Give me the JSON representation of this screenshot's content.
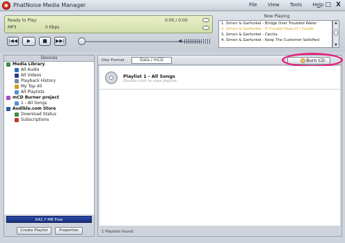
{
  "window": {
    "title": "PhatNoise Media Manager"
  },
  "menu": [
    "File",
    "View",
    "Tools",
    "Help"
  ],
  "window_controls": "_ □ X",
  "player": {
    "status": "Ready to Play:",
    "format": "MP3",
    "bitrate": "0 Kbps",
    "time": "0:00 / 0:00",
    "buttons": [
      "prev",
      "play",
      "stop",
      "next"
    ]
  },
  "now_playing": {
    "header": "Now Playing",
    "tracks": [
      "1. Simon & Garfunkel - Bridge Over Troubled Water",
      "2. Simon & Garfunkel - El Condor Pasa (If I Could)",
      "3. Simon & Garfunkel - Cecilia",
      "4. Simon & Garfunkel - Keep The Customer Satisfied"
    ],
    "active_index": 1
  },
  "devices": {
    "header": "Devices",
    "tree": [
      {
        "label": "Media Library",
        "bold": true,
        "indent": 0,
        "icon": "library-icon"
      },
      {
        "label": "All Audio",
        "indent": 1,
        "icon": "headphones-icon"
      },
      {
        "label": "All Videos",
        "indent": 1,
        "icon": "video-icon"
      },
      {
        "label": "Playback History",
        "indent": 1,
        "icon": "history-icon"
      },
      {
        "label": "My Top 40",
        "indent": 1,
        "icon": "top40-icon"
      },
      {
        "label": "All Playlists",
        "indent": 1,
        "icon": "playlists-icon"
      },
      {
        "label": "mCD Burner project",
        "bold": true,
        "indent": 0,
        "icon": "cd-burner-icon"
      },
      {
        "label": "1 - All Songs",
        "indent": 1,
        "icon": "playlist-icon"
      },
      {
        "label": "Audible.com Store",
        "bold": true,
        "indent": 0,
        "icon": "audible-icon"
      },
      {
        "label": "Download Status",
        "indent": 1,
        "icon": "download-icon"
      },
      {
        "label": "Subscriptions",
        "indent": 1,
        "icon": "subscriptions-icon"
      }
    ],
    "free_space": "642.7 MB Free",
    "create_playlist": "Create Playlist",
    "properties": "Properties"
  },
  "disc": {
    "format_label": "Disc Format",
    "format_value": "Data / mCD",
    "burn_label": "Burn CD"
  },
  "playlist": {
    "name": "Playlist 1 - All Songs",
    "hint": "Double-click to view playlist."
  },
  "status": "1 Playlists found."
}
